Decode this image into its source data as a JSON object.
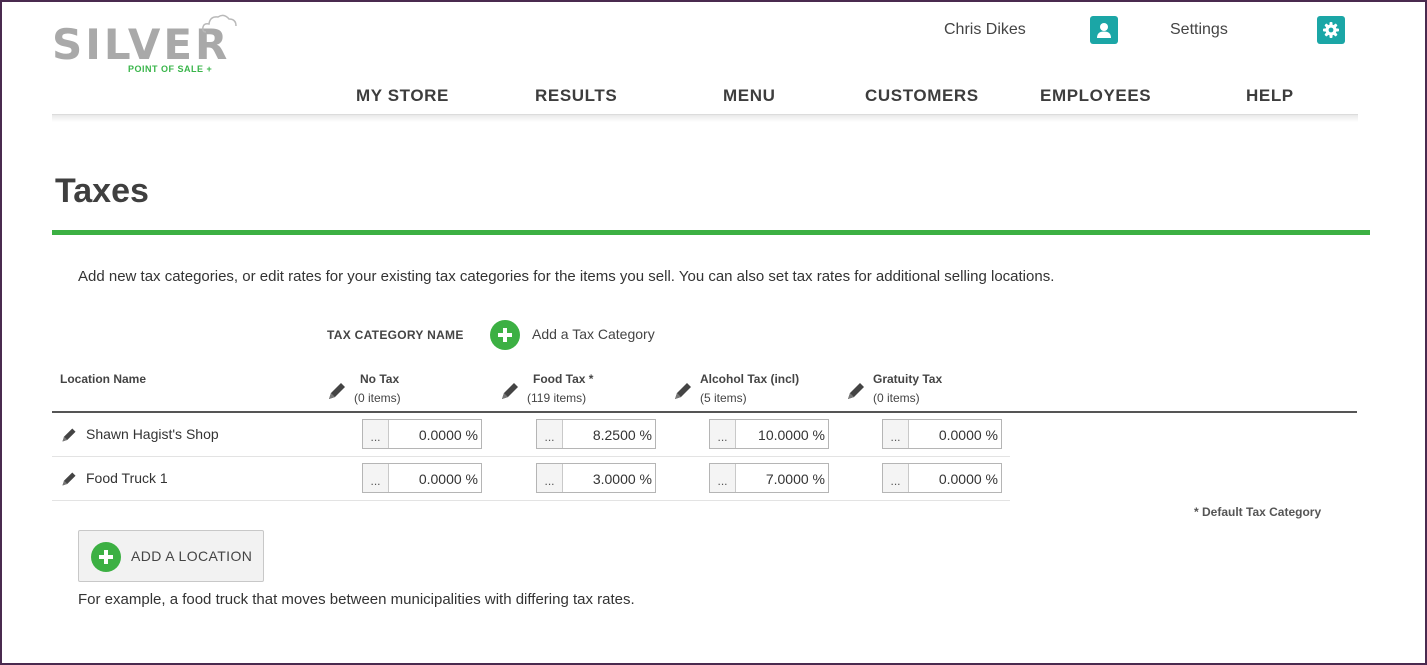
{
  "header": {
    "logo_text": "SILVER",
    "logo_tagline": "POINT OF SALE +",
    "user_name": "Chris Dikes",
    "settings_label": "Settings"
  },
  "nav": {
    "items": [
      {
        "label": "MY STORE"
      },
      {
        "label": "RESULTS"
      },
      {
        "label": "MENU"
      },
      {
        "label": "CUSTOMERS"
      },
      {
        "label": "EMPLOYEES"
      },
      {
        "label": "HELP"
      }
    ]
  },
  "page": {
    "title": "Taxes",
    "intro": "Add new tax categories, or edit rates for your existing tax categories for the items you sell. You can also set tax rates for additional selling locations."
  },
  "tax_categories": {
    "header_label": "TAX CATEGORY NAME",
    "add_label": "Add a Tax Category",
    "location_header": "Location Name",
    "columns": [
      {
        "name": "No Tax",
        "count": "(0 items)"
      },
      {
        "name": "Food Tax *",
        "count": "(119 items)"
      },
      {
        "name": "Alcohol Tax (incl)",
        "count": "(5 items)"
      },
      {
        "name": "Gratuity Tax",
        "count": "(0 items)"
      }
    ]
  },
  "locations": [
    {
      "name": "Shawn Hagist's Shop",
      "rates": [
        "0.0000 %",
        "8.2500 %",
        "10.0000 %",
        "0.0000 %"
      ]
    },
    {
      "name": "Food Truck 1",
      "rates": [
        "0.0000 %",
        "3.0000 %",
        "7.0000 %",
        "0.0000 %"
      ]
    }
  ],
  "dots_label": "...",
  "default_note": "* Default Tax Category",
  "add_location": {
    "label": "ADD A LOCATION",
    "example": "For example, a food truck that moves between municipalities with differing tax rates."
  },
  "colors": {
    "accent_green": "#3cb043",
    "icon_teal": "#1ba6a6"
  }
}
